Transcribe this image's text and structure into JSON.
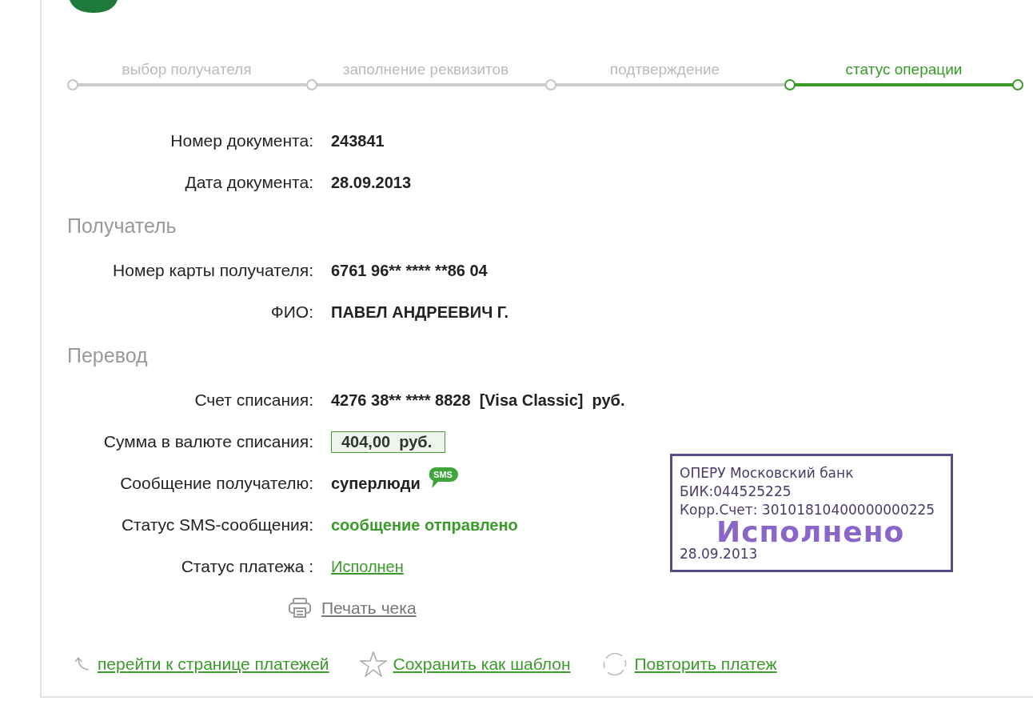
{
  "steps": [
    {
      "label": "выбор получателя",
      "selected": false
    },
    {
      "label": "заполнение реквизитов",
      "selected": false
    },
    {
      "label": "подтверждение",
      "selected": false
    },
    {
      "label": "статус операции",
      "selected": true
    }
  ],
  "sections": [
    {
      "rows": [
        {
          "label": "Номер документа:",
          "value": "243841",
          "kind": "text"
        },
        {
          "label": "Дата документа:",
          "value": "28.09.2013",
          "kind": "text"
        }
      ]
    },
    {
      "heading": "Получатель",
      "rows": [
        {
          "label": "Номер карты получателя:",
          "value": "6761 96** **** **86 04",
          "kind": "text"
        },
        {
          "label": "ФИО:",
          "value": "ПАВЕЛ АНДРЕЕВИЧ Г.",
          "kind": "text"
        }
      ]
    },
    {
      "heading": "Перевод",
      "rows": [
        {
          "label": "Счет списания:",
          "value": "4276 38** **** 8828  [Visa Classic]  руб.",
          "kind": "text"
        },
        {
          "label": "Сумма в валюте списания:",
          "value": "404,00  руб.",
          "kind": "amount"
        },
        {
          "label": "Сообщение получателю:",
          "value": "суперлюди",
          "kind": "message",
          "sms_badge": "SMS"
        },
        {
          "label": "Статус SMS-сообщения:",
          "value": "сообщение отправлено",
          "kind": "status"
        },
        {
          "label": "Статус платежа :",
          "value": "Исполнен",
          "kind": "link"
        }
      ]
    }
  ],
  "stamp": {
    "bank": "ОПЕРУ Московский банк",
    "bik": "БИК:044525225",
    "account": "Корр.Счет: 30101810400000000225",
    "status": "Исполнено",
    "date": "28.09.2013"
  },
  "print_link": "Печать чека",
  "actions": [
    {
      "label": "перейти к странице платежей",
      "kind": "back"
    },
    {
      "label": "Сохранить как шаблон",
      "kind": "star"
    },
    {
      "label": "Повторить платеж",
      "kind": "repeat"
    }
  ]
}
